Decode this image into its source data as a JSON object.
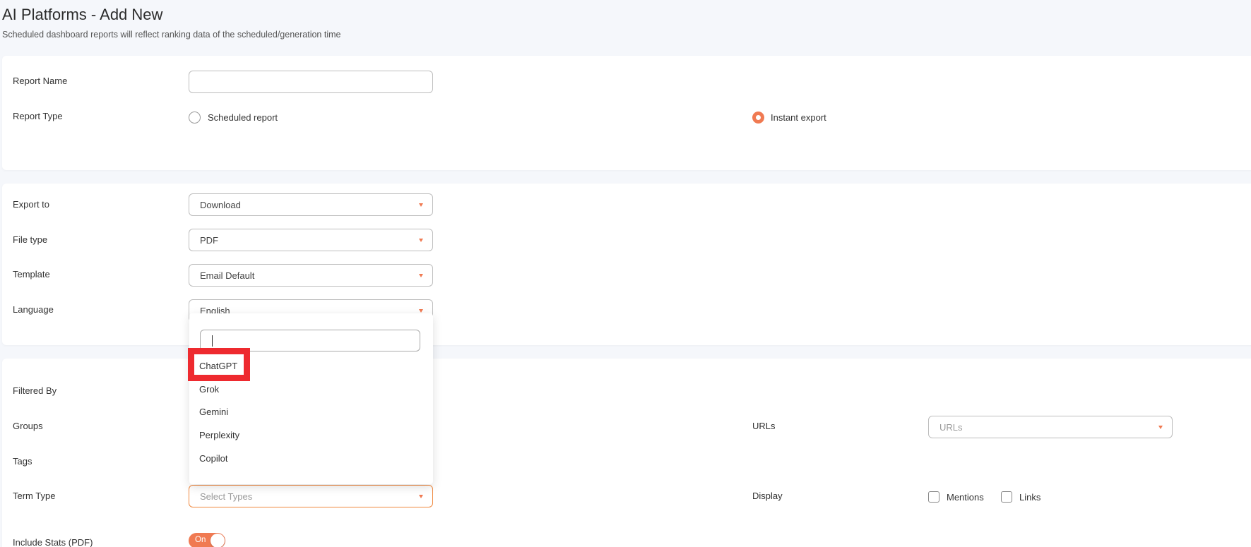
{
  "header": {
    "title": "AI Platforms - Add New",
    "subtitle": "Scheduled dashboard reports will reflect ranking data of the scheduled/generation time"
  },
  "report": {
    "name_label": "Report Name",
    "name_value": "",
    "type_label": "Report Type",
    "type_options": [
      "Scheduled report",
      "Instant export"
    ],
    "type_selected": "Instant export"
  },
  "export": {
    "export_to_label": "Export to",
    "export_to_value": "Download",
    "file_type_label": "File type",
    "file_type_value": "PDF",
    "template_label": "Template",
    "template_value": "Email Default",
    "language_label": "Language",
    "language_value": "English"
  },
  "filters": {
    "filtered_by_label": "Filtered By",
    "groups_label": "Groups",
    "tags_label": "Tags",
    "urls_label": "URLs",
    "urls_placeholder": "URLs",
    "term_type_label": "Term Type",
    "term_type_placeholder": "Select Types",
    "display_label": "Display",
    "display_options": [
      "Mentions",
      "Links"
    ],
    "include_stats_label": "Include Stats (PDF)",
    "include_stats_toggle": "On"
  },
  "dropdown": {
    "search_value": "",
    "options": [
      "ChatGPT",
      "Grok",
      "Gemini",
      "Perplexity",
      "Copilot"
    ],
    "highlighted": "ChatGPT"
  },
  "colors": {
    "accent": "#f07a52",
    "focus_border": "#f0883e",
    "highlight": "#ee2a2f",
    "background": "#f5f7fb"
  }
}
